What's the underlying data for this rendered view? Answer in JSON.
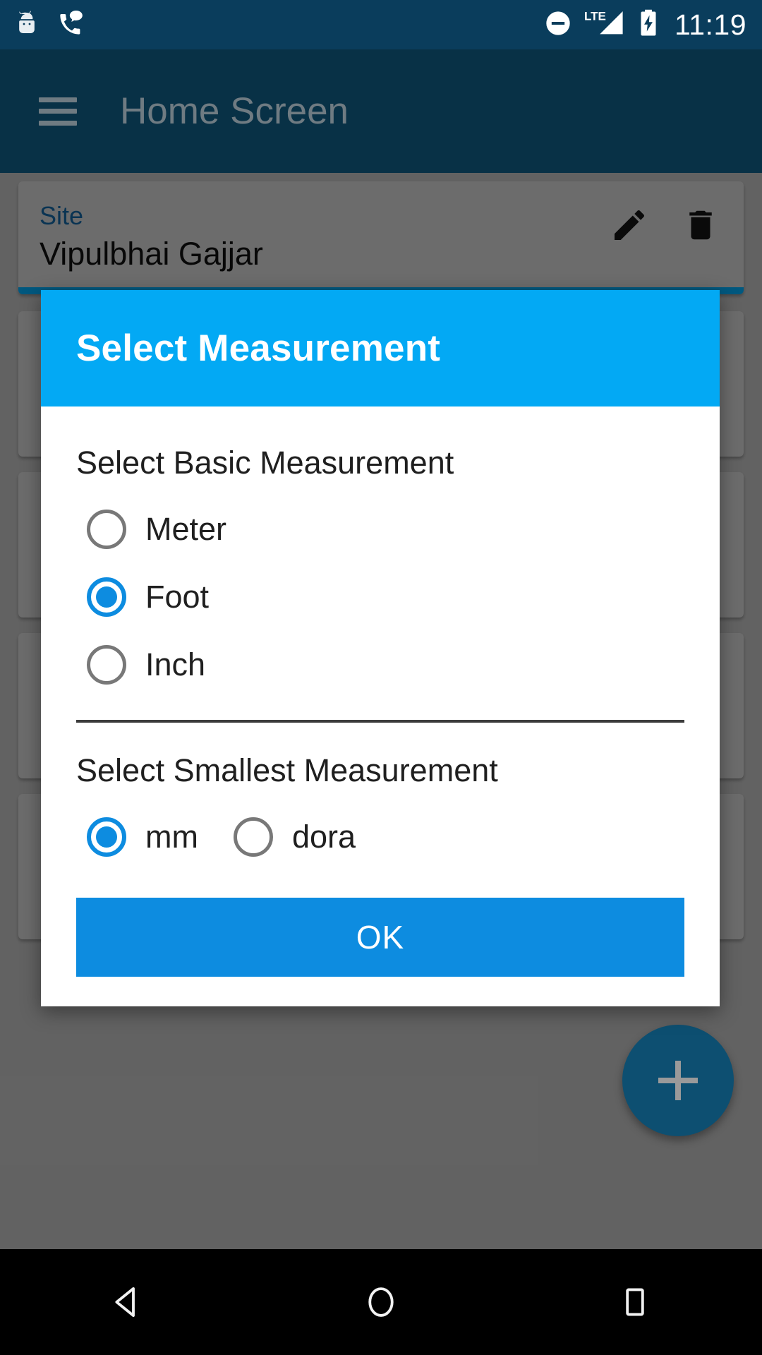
{
  "status_bar": {
    "time": "11:19",
    "notification_icons": [
      {
        "name": "android-mascot-icon"
      },
      {
        "name": "phone-message-icon"
      }
    ],
    "system_icons": [
      {
        "name": "do-not-disturb-icon"
      },
      {
        "name": "lte-signal-icon",
        "label": "LTE"
      },
      {
        "name": "battery-charging-icon"
      }
    ]
  },
  "toolbar": {
    "menu_icon": "hamburger-menu-icon",
    "title": "Home Screen"
  },
  "content": {
    "cards": [
      {
        "label": "Site",
        "value": "Vipulbhai Gajjar",
        "edit_icon": "pencil-edit-icon",
        "delete_icon": "trash-delete-icon"
      },
      {
        "label": "",
        "value": ""
      },
      {
        "label": "",
        "value": ""
      },
      {
        "label": "",
        "value": ""
      },
      {
        "label": "",
        "value": ""
      }
    ],
    "fab": {
      "icon": "plus-icon"
    }
  },
  "dialog": {
    "title": "Select Measurement",
    "basic": {
      "label": "Select Basic Measurement",
      "options": [
        {
          "label": "Meter",
          "selected": false
        },
        {
          "label": "Foot",
          "selected": true
        },
        {
          "label": "Inch",
          "selected": false
        }
      ]
    },
    "smallest": {
      "label": "Select Smallest Measurement",
      "options": [
        {
          "label": "mm",
          "selected": true
        },
        {
          "label": "dora",
          "selected": false
        }
      ]
    },
    "ok_label": "OK"
  },
  "nav_bar": {
    "back": "back-triangle-icon",
    "home": "home-circle-icon",
    "recents": "recents-square-icon"
  },
  "colors": {
    "status_bar": "#0a3d5c",
    "toolbar": "#0d4f71",
    "accent": "#03a9f4",
    "radio_selected": "#0d8ce0",
    "radio_unselected": "#787878",
    "scrim": "rgba(0,0,0,0.48)"
  }
}
